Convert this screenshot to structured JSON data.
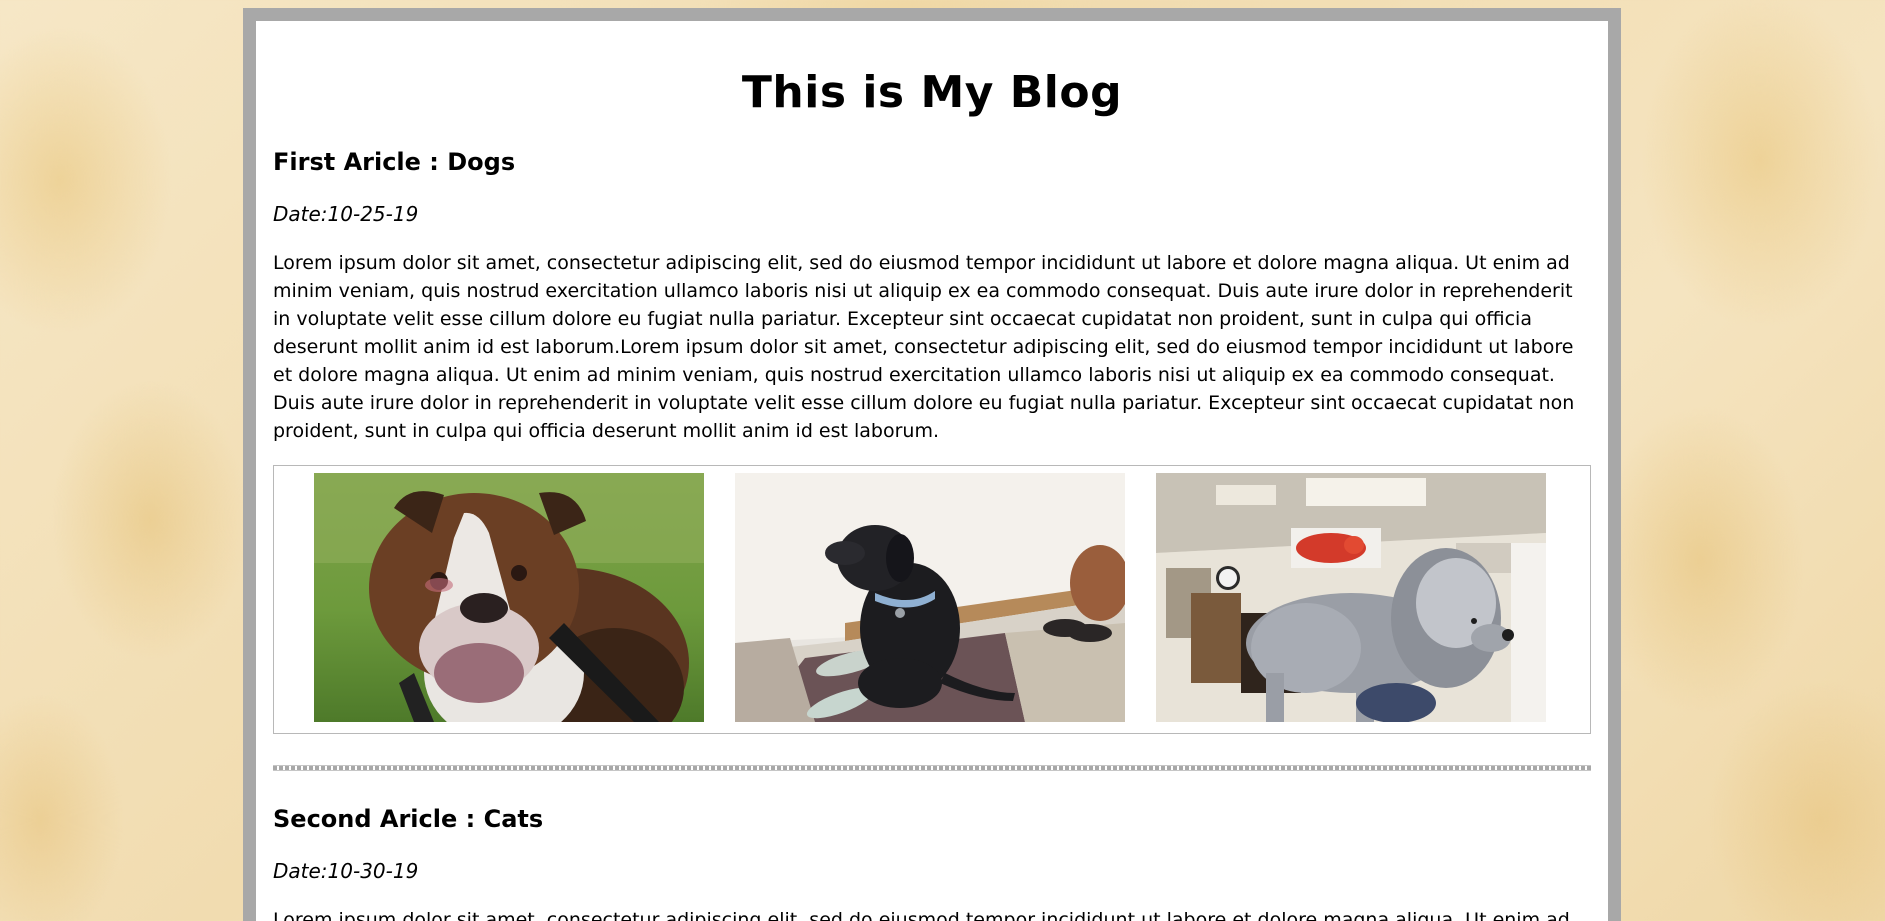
{
  "blog": {
    "title": "This is My Blog"
  },
  "articles": [
    {
      "heading": "First Aricle : Dogs",
      "date": "Date:10-25-19",
      "body": "Lorem ipsum dolor sit amet, consectetur adipiscing elit, sed do eiusmod tempor incididunt ut labore et dolore magna aliqua. Ut enim ad minim veniam, quis nostrud exercitation ullamco laboris nisi ut aliquip ex ea commodo consequat. Duis aute irure dolor in reprehenderit in voluptate velit esse cillum dolore eu fugiat nulla pariatur. Excepteur sint occaecat cupidatat non proident, sunt in culpa qui officia deserunt mollit anim id est laborum.Lorem ipsum dolor sit amet, consectetur adipiscing elit, sed do eiusmod tempor incididunt ut labore et dolore magna aliqua. Ut enim ad minim veniam, quis nostrud exercitation ullamco laboris nisi ut aliquip ex ea commodo consequat. Duis aute irure dolor in reprehenderit in voluptate velit esse cillum dolore eu fugiat nulla pariatur. Excepteur sint occaecat cupidatat non proident, sunt in culpa qui officia deserunt mollit anim id est laborum.",
      "photos": [
        {
          "subject": "bulldog-photo"
        },
        {
          "subject": "black-dog-photo"
        },
        {
          "subject": "shaggy-dog-photo"
        }
      ]
    },
    {
      "heading": "Second Aricle : Cats",
      "date": "Date:10-30-19",
      "body": "Lorem ipsum dolor sit amet, consectetur adipiscing elit, sed do eiusmod tempor incididunt ut labore et dolore magna aliqua. Ut enim ad minim veniam, quis nostrud exercitation ullamco laboris nisi ut aliquip ex ea commodo consequat."
    }
  ],
  "colors": {
    "frame": "#a8a8a8",
    "page": "#ffffff",
    "background": "#f3e2bd",
    "text": "#000000"
  }
}
